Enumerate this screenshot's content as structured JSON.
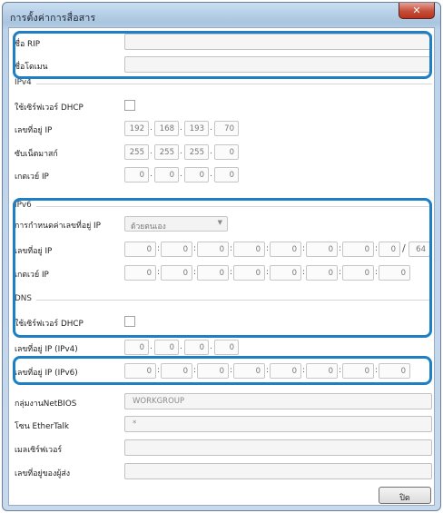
{
  "window": {
    "title": "การตั้งค่าการสื่อสาร",
    "close_glyph": "✕"
  },
  "rip": {
    "label": "ชื่อ RIP",
    "value": ""
  },
  "domain": {
    "label": "ชื่อโดเมน",
    "value": ""
  },
  "ipv4": {
    "section": "IPv4",
    "dhcp_label": "ใช้เซิร์ฟเวอร์ DHCP",
    "ip_label": "เลขที่อยู่ IP",
    "ip": [
      "192",
      "168",
      "193",
      "70"
    ],
    "mask_label": "ซับเน็ตมาสก์",
    "mask": [
      "255",
      "255",
      "255",
      "0"
    ],
    "gateway_label": "เกตเวย์ IP",
    "gateway": [
      "0",
      "0",
      "0",
      "0"
    ]
  },
  "ipv6": {
    "section": "IPv6",
    "assign_label": "การกำหนดค่าเลขที่อยู่ IP",
    "assign_value": "ด้วยตนเอง",
    "ip_label": "เลขที่อยู่ IP",
    "ip": [
      "0",
      "0",
      "0",
      "0",
      "0",
      "0",
      "0",
      "0"
    ],
    "prefix": "64",
    "gateway_label": "เกตเวย์ IP",
    "gateway": [
      "0",
      "0",
      "0",
      "0",
      "0",
      "0",
      "0",
      "0"
    ]
  },
  "dns": {
    "section": "DNS",
    "dhcp_label": "ใช้เซิร์ฟเวอร์ DHCP",
    "ipv4_label": "เลขที่อยู่ IP (IPv4)",
    "ipv4": [
      "0",
      "0",
      "0",
      "0"
    ],
    "ipv6_label": "เลขที่อยู่ IP (IPv6)",
    "ipv6": [
      "0",
      "0",
      "0",
      "0",
      "0",
      "0",
      "0",
      "0"
    ]
  },
  "netbios": {
    "label": "กลุ่มงานNetBIOS",
    "value": "WORKGROUP"
  },
  "ethertalk": {
    "label": "โซน EtherTalk",
    "value": "*"
  },
  "mailserver": {
    "label": "เมลเซิร์ฟเวอร์",
    "value": ""
  },
  "sender": {
    "label": "เลขที่อยู่ของผู้ส่ง",
    "value": ""
  },
  "buttons": {
    "close": "ปิด"
  },
  "accent_color": "#1f7fc4"
}
